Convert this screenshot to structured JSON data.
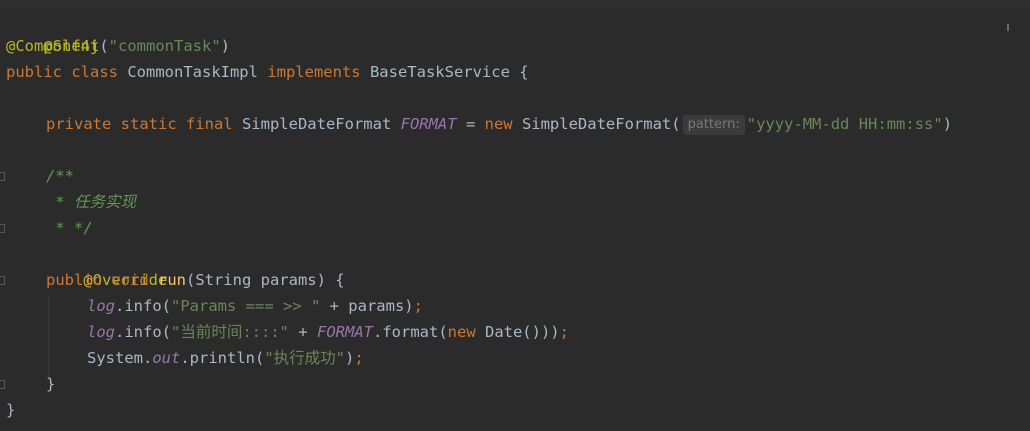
{
  "editor": {
    "lines": {
      "l1": {
        "annotation": "@Slf4j"
      },
      "l2": {
        "annotation": "@Component",
        "open": "(",
        "arg": "\"commonTask\"",
        "close": ")"
      },
      "l3": {
        "kw": "public class ",
        "name": "CommonTaskImpl ",
        "kw2": "implements ",
        "iface": "BaseTaskService ",
        "brace": "{"
      },
      "l5": {
        "mods": "private static final ",
        "type": "SimpleDateFormat ",
        "field": "FORMAT",
        "eq": " = ",
        "new": "new ",
        "ctor": "SimpleDateFormat(",
        "hint": "pattern:",
        "arg": "\"yyyy-MM-dd HH:mm:ss\"",
        "close": ")"
      },
      "l7": {
        "text": "/**"
      },
      "l8": {
        "text": " * 任务实现"
      },
      "l9": {
        "text": " * */"
      },
      "l10": {
        "annotation": "@Override"
      },
      "l11": {
        "kw": "public void ",
        "method": "run",
        "params": "(String params) {"
      },
      "l12": {
        "field": "log",
        "call": ".info(",
        "str": "\"Params === >> \"",
        "rest": " + params)",
        "semi": ";"
      },
      "l13": {
        "field": "log",
        "call": ".info(",
        "str": "\"当前时间::::\"",
        "plus": " + ",
        "field2": "FORMAT",
        "call2": ".format(",
        "new": "new ",
        "rest": "Date()))",
        "semi": ";"
      },
      "l14": {
        "cls": "System.",
        "field": "out",
        "call": ".println(",
        "str": "\"执行成功\"",
        "close": ")",
        "semi": ";"
      },
      "l15": {
        "text": "}"
      },
      "l16": {
        "text": "}"
      }
    }
  }
}
